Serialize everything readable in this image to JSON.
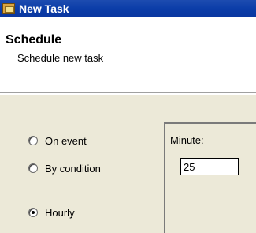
{
  "window": {
    "title": "New Task"
  },
  "header": {
    "title": "Schedule",
    "subtitle": "Schedule new task"
  },
  "trigger_options": [
    {
      "label": "On event",
      "checked": false
    },
    {
      "label": "By condition",
      "checked": false
    },
    {
      "label": "Hourly",
      "checked": true
    }
  ],
  "minute": {
    "label": "Minute:",
    "value": "25"
  }
}
